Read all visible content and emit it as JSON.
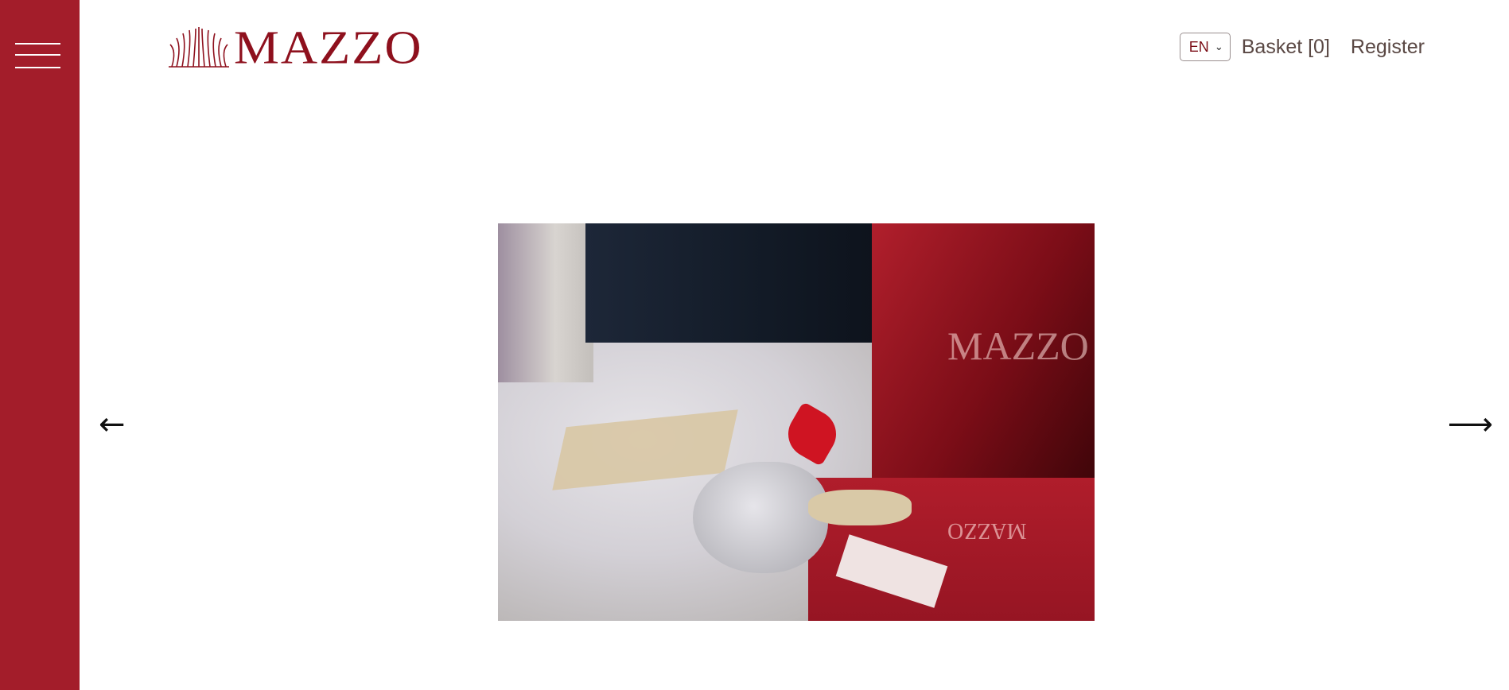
{
  "brand": {
    "name": "MAZZO",
    "accent_color": "#a31d2a",
    "logo_color": "#8e101d"
  },
  "sidebar": {
    "menu_icon": "hamburger-menu-icon"
  },
  "header": {
    "language": {
      "selected": "EN",
      "icon": "chevron-down-icon"
    },
    "basket_label": "Basket [0]",
    "register_label": "Register"
  },
  "slider": {
    "prev_arrow": "←",
    "next_arrow": "⟶",
    "image": {
      "box_text": "MAZZO",
      "bag_text": "MAZZO"
    }
  }
}
